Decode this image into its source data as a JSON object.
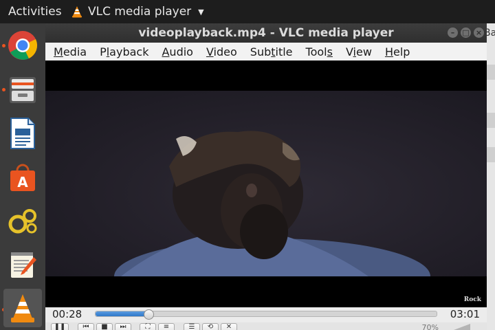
{
  "panel": {
    "activities": "Activities",
    "app_name": "VLC media player",
    "app_menu_icon": "chevron-down-icon"
  },
  "dock": {
    "items": [
      {
        "name": "chrome",
        "icon": "chrome-icon",
        "running": true
      },
      {
        "name": "files",
        "icon": "file-cabinet-icon",
        "running": true
      },
      {
        "name": "writer",
        "icon": "libreoffice-writer-icon",
        "running": false
      },
      {
        "name": "software",
        "icon": "software-store-icon",
        "running": false
      },
      {
        "name": "system-tool",
        "icon": "gears-icon",
        "running": false
      },
      {
        "name": "text-editor",
        "icon": "text-editor-icon",
        "running": false
      },
      {
        "name": "vlc",
        "icon": "vlc-cone-icon",
        "running": true,
        "active": true
      }
    ]
  },
  "background_window": {
    "title_fragment": "Ba"
  },
  "window": {
    "title": "videoplayback.mp4 - VLC media player",
    "controls": [
      "minimize",
      "maximize",
      "close"
    ]
  },
  "menu": {
    "items": [
      {
        "label": "Media",
        "accel": "M"
      },
      {
        "label": "Playback",
        "accel": "l"
      },
      {
        "label": "Audio",
        "accel": "A"
      },
      {
        "label": "Video",
        "accel": "V"
      },
      {
        "label": "Subtitle",
        "accel": "t"
      },
      {
        "label": "Tools",
        "accel": "s"
      },
      {
        "label": "View",
        "accel": "i"
      },
      {
        "label": "Help",
        "accel": "H"
      }
    ]
  },
  "video": {
    "watermark": "Rock"
  },
  "playback": {
    "elapsed": "00:28",
    "total": "03:01",
    "progress": 0.155,
    "volume_label": "70%"
  },
  "colors": {
    "accent": "#2f78c8",
    "dock_dot": "#e95420",
    "panel_bg": "#1d1d1d"
  }
}
